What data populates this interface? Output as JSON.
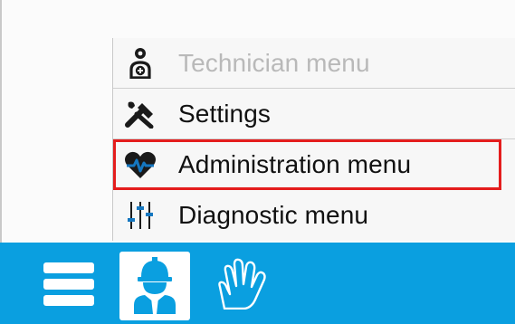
{
  "menu": {
    "items": [
      {
        "label": "Technician menu",
        "icon": "technician-icon",
        "state": "disabled"
      },
      {
        "label": "Settings",
        "icon": "tools-icon",
        "state": "normal"
      },
      {
        "label": "Administration menu",
        "icon": "heart-pulse-icon",
        "state": "selected"
      },
      {
        "label": "Diagnostic menu",
        "icon": "sliders-icon",
        "state": "normal"
      }
    ],
    "selected_index": 2
  },
  "taskbar": {
    "buttons": [
      {
        "icon": "hamburger-menu-icon"
      },
      {
        "icon": "worker-user-icon",
        "active": true
      },
      {
        "icon": "hand-icon"
      }
    ]
  },
  "colors": {
    "taskbar_bg": "#0a9fe0",
    "selection_outline": "#e41d1d",
    "disabled_text": "#b9b9b9",
    "text": "#111111",
    "icon_dark": "#1a1a1a",
    "accent": "#1577c0"
  }
}
